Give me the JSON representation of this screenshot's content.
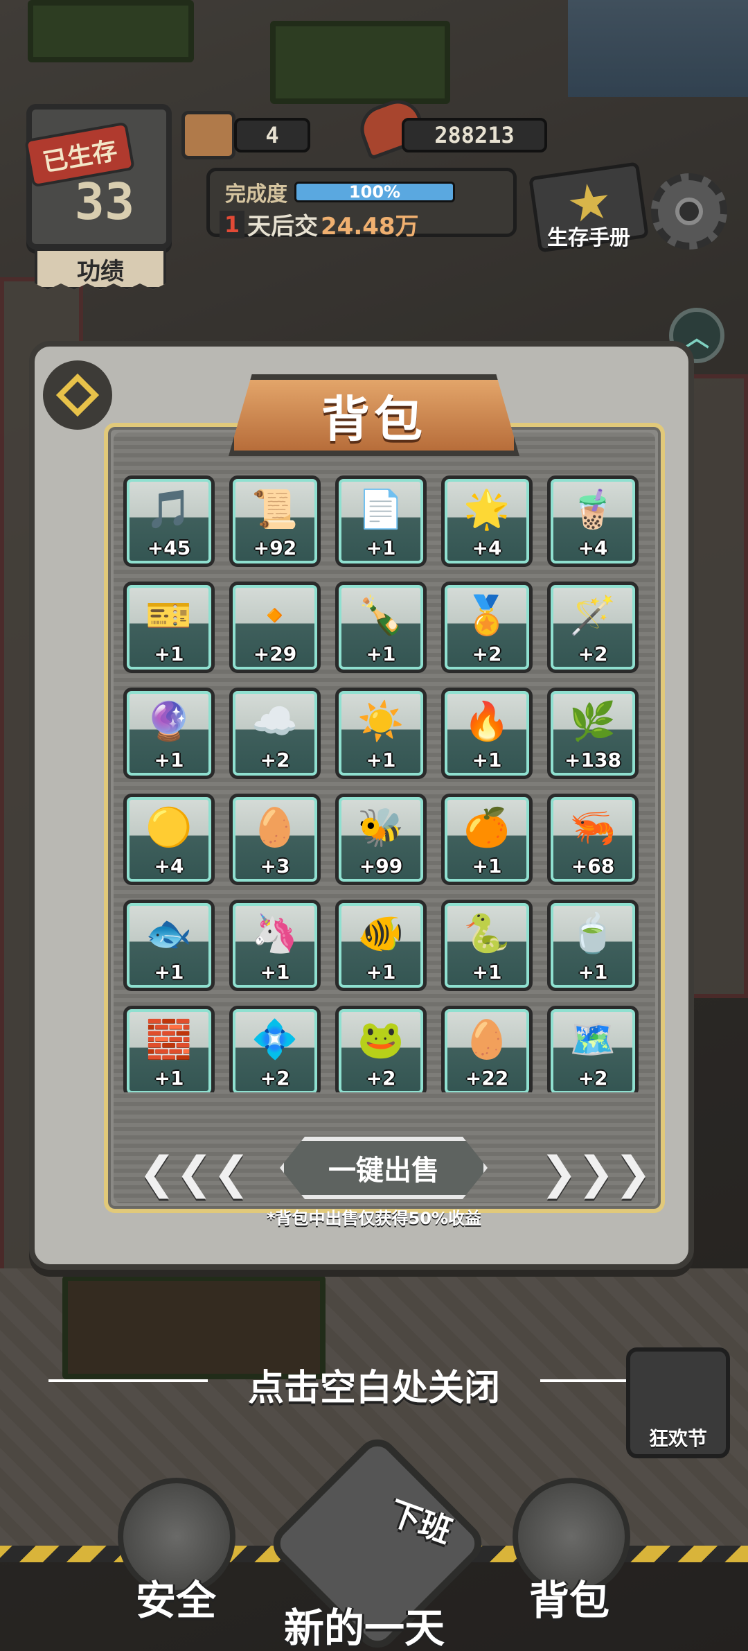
{
  "hud": {
    "survived_label": "已生存",
    "days": "33",
    "merit_label": "功绩",
    "can_count": "4",
    "meat_count": "288213",
    "completion_label": "完成度",
    "completion_pct": "100%",
    "completion_value": 1.0,
    "due_days": "1",
    "due_text": "天后交",
    "due_amount": "24.48万",
    "manual_label": "生存手册"
  },
  "panel": {
    "title": "背包",
    "sell_button": "一键出售",
    "sell_note": "*背包中出售仅获得50%收益"
  },
  "items": [
    {
      "icon": "music-note-icon",
      "glyph": "🎵",
      "qty": "+45"
    },
    {
      "icon": "paper-scroll-icon",
      "glyph": "📜",
      "qty": "+92"
    },
    {
      "icon": "contract-icon",
      "glyph": "📄",
      "qty": "+1"
    },
    {
      "icon": "glowing-sun-orb-icon",
      "glyph": "🌟",
      "qty": "+4"
    },
    {
      "icon": "bubble-tea-icon",
      "glyph": "🧋",
      "qty": "+4"
    },
    {
      "icon": "ticket-icon",
      "glyph": "🎫",
      "qty": "+1"
    },
    {
      "icon": "bullet-icon",
      "glyph": "🔸",
      "qty": "+29"
    },
    {
      "icon": "soda-bottle-icon",
      "glyph": "🍾",
      "qty": "+1"
    },
    {
      "icon": "medal-badge-icon",
      "glyph": "🏅",
      "qty": "+2"
    },
    {
      "icon": "magic-staff-icon",
      "glyph": "🪄",
      "qty": "+2"
    },
    {
      "icon": "magic-circle-icon",
      "glyph": "🔮",
      "qty": "+1"
    },
    {
      "icon": "cloud-icon",
      "glyph": "☁️",
      "qty": "+2"
    },
    {
      "icon": "sun-icon",
      "glyph": "☀️",
      "qty": "+1"
    },
    {
      "icon": "blue-flame-icon",
      "glyph": "🔥",
      "qty": "+1"
    },
    {
      "icon": "ginseng-root-icon",
      "glyph": "🌿",
      "qty": "+138"
    },
    {
      "icon": "golden-orb-icon",
      "glyph": "🟡",
      "qty": "+4"
    },
    {
      "icon": "egg-icon",
      "glyph": "🥚",
      "qty": "+3"
    },
    {
      "icon": "bee-fish-icon",
      "glyph": "🐝",
      "qty": "+99"
    },
    {
      "icon": "devil-fruit-icon",
      "glyph": "🍊",
      "qty": "+1"
    },
    {
      "icon": "shrimp-icon",
      "glyph": "🦐",
      "qty": "+68"
    },
    {
      "icon": "koi-fish-icon",
      "glyph": "🐟",
      "qty": "+1"
    },
    {
      "icon": "seahorse-icon",
      "glyph": "🦄",
      "qty": "+1"
    },
    {
      "icon": "blue-fish-icon",
      "glyph": "🐠",
      "qty": "+1"
    },
    {
      "icon": "snake-coil-icon",
      "glyph": "🐍",
      "qty": "+1"
    },
    {
      "icon": "green-drink-icon",
      "glyph": "🍵",
      "qty": "+1"
    },
    {
      "icon": "chip-box-icon",
      "glyph": "🧱",
      "qty": "+1"
    },
    {
      "icon": "energy-orb-icon",
      "glyph": "💠",
      "qty": "+2"
    },
    {
      "icon": "frog-icon",
      "glyph": "🐸",
      "qty": "+2"
    },
    {
      "icon": "dragon-scale-icon",
      "glyph": "🥚",
      "qty": "+22"
    },
    {
      "icon": "treasure-map-icon",
      "glyph": "🗺️",
      "qty": "+2"
    }
  ],
  "close_hint": "点击空白处关闭",
  "carnival_label": "狂欢节",
  "nav": {
    "safety": "安全",
    "new_day": "新的一天",
    "off_work": "下班",
    "backpack": "背包"
  },
  "colors": {
    "accent_orange": "#d88a4e",
    "teal_cell": "#8fe0d0",
    "gold_border": "#e1c97a",
    "due_red": "#e34a36"
  }
}
